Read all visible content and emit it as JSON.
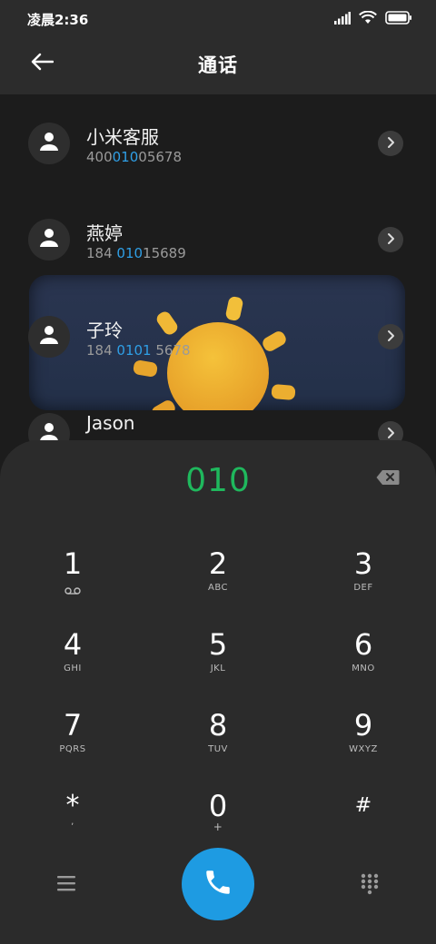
{
  "status_bar": {
    "time": "凌晨2:36",
    "icons": [
      "signal-icon",
      "wifi-icon",
      "battery-icon"
    ]
  },
  "header": {
    "title": "通话",
    "back_icon": "back-arrow-icon"
  },
  "contacts": [
    {
      "name": "小米客服",
      "number_pre": "400",
      "number_hl": "010",
      "number_post": "05678"
    },
    {
      "name": "燕婷",
      "number_pre": "184 ",
      "number_hl": "010",
      "number_post": "15689"
    },
    {
      "name": "子玲",
      "number_pre": "184 ",
      "number_hl": "0101",
      "number_post": " 5678"
    },
    {
      "name": "Jason",
      "number_pre": "",
      "number_hl": "",
      "number_post": ""
    }
  ],
  "dialer": {
    "input": "010",
    "keys": [
      {
        "digit": "1",
        "letters": ""
      },
      {
        "digit": "2",
        "letters": "ABC"
      },
      {
        "digit": "3",
        "letters": "DEF"
      },
      {
        "digit": "4",
        "letters": "GHI"
      },
      {
        "digit": "5",
        "letters": "JKL"
      },
      {
        "digit": "6",
        "letters": "MNO"
      },
      {
        "digit": "7",
        "letters": "PQRS"
      },
      {
        "digit": "8",
        "letters": "TUV"
      },
      {
        "digit": "9",
        "letters": "WXYZ"
      },
      {
        "digit": "*",
        "letters": ","
      },
      {
        "digit": "0",
        "letters": "+"
      },
      {
        "digit": "#",
        "letters": ""
      }
    ]
  },
  "colors": {
    "accent_green": "#1fb85d",
    "accent_blue": "#1e9be2",
    "highlight_blue": "#2f9fe6"
  }
}
